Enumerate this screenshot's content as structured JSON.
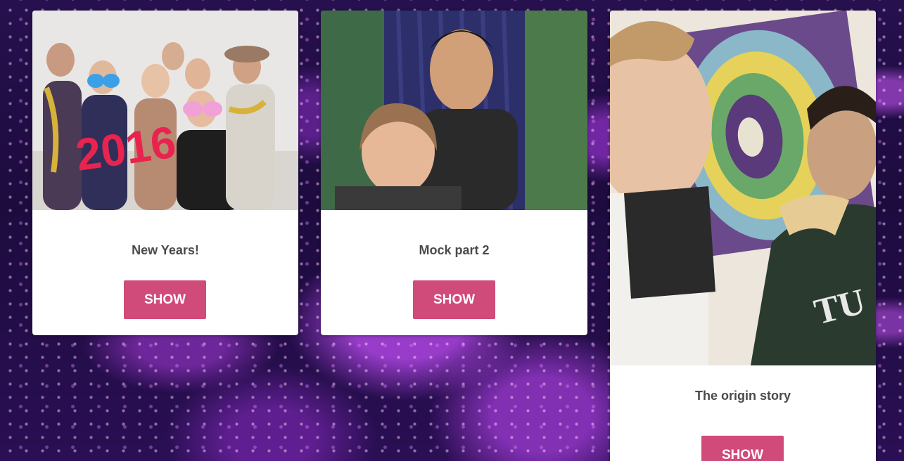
{
  "cards": [
    {
      "title": "New Years!",
      "button_label": "SHOW",
      "photo_text": "2016"
    },
    {
      "title": "Mock part 2",
      "button_label": "SHOW"
    },
    {
      "title": "The origin story",
      "button_label": "SHOW",
      "photo_text": "TU"
    }
  ],
  "colors": {
    "button": "#d04a7a",
    "title_text": "#4a4a4a",
    "card_bg": "#ffffff",
    "page_bg": "#26104e"
  }
}
